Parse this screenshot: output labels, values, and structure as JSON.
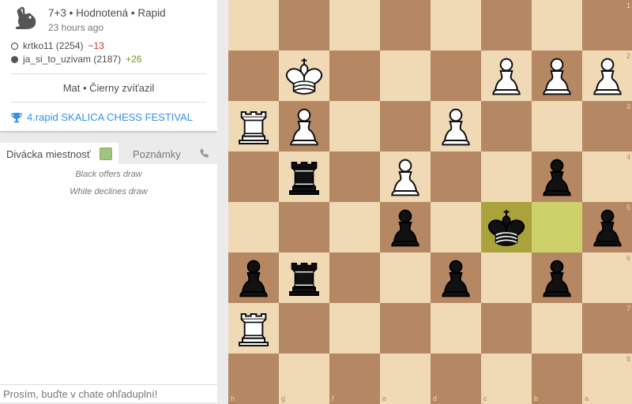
{
  "game": {
    "setup": "7+3 • Hodnotená • Rapid",
    "time_ago": "23 hours ago",
    "players": [
      {
        "name": "krtko11 (2254)",
        "diff": "−13",
        "color": "white"
      },
      {
        "name": "ja_si_to_uzivam (2187)",
        "diff": "+26",
        "color": "black"
      }
    ],
    "result": "Mat • Čierny zvíťazil",
    "tournament": "4.rapid SKALICA CHESS FESTIVAL",
    "icon": "rabbit-icon"
  },
  "chat": {
    "tab_label": "Divácka miestnosť",
    "notes_label": "Poznámky",
    "messages": [
      "Black offers draw",
      "White declines draw"
    ],
    "input_placeholder": "Prosím, buďte v chate ohľaduplní!"
  },
  "board": {
    "orientation": "black",
    "files": [
      "h",
      "g",
      "f",
      "e",
      "d",
      "c",
      "b",
      "a"
    ],
    "ranks": [
      "1",
      "2",
      "3",
      "4",
      "5",
      "6",
      "7",
      "8"
    ],
    "last_move": [
      "c5",
      "b5"
    ],
    "pieces": [
      {
        "square": "g2",
        "type": "king",
        "color": "white"
      },
      {
        "square": "c2",
        "type": "pawn",
        "color": "white"
      },
      {
        "square": "b2",
        "type": "pawn",
        "color": "white"
      },
      {
        "square": "a2",
        "type": "pawn",
        "color": "white"
      },
      {
        "square": "h3",
        "type": "rook",
        "color": "white"
      },
      {
        "square": "g3",
        "type": "pawn",
        "color": "white"
      },
      {
        "square": "d3",
        "type": "pawn",
        "color": "white"
      },
      {
        "square": "g4",
        "type": "rook",
        "color": "black"
      },
      {
        "square": "e4",
        "type": "pawn",
        "color": "white"
      },
      {
        "square": "b4",
        "type": "pawn",
        "color": "black"
      },
      {
        "square": "e5",
        "type": "pawn",
        "color": "black"
      },
      {
        "square": "c5",
        "type": "king",
        "color": "black"
      },
      {
        "square": "a5",
        "type": "pawn",
        "color": "black"
      },
      {
        "square": "h6",
        "type": "pawn",
        "color": "black"
      },
      {
        "square": "g6",
        "type": "rook",
        "color": "black"
      },
      {
        "square": "d6",
        "type": "pawn",
        "color": "black"
      },
      {
        "square": "b6",
        "type": "pawn",
        "color": "black"
      },
      {
        "square": "h7",
        "type": "rook",
        "color": "white"
      }
    ]
  },
  "colors": {
    "light_square": "#f0d9b5",
    "dark_square": "#b58863",
    "highlight": "#cdd16a",
    "link": "#3692e7"
  }
}
